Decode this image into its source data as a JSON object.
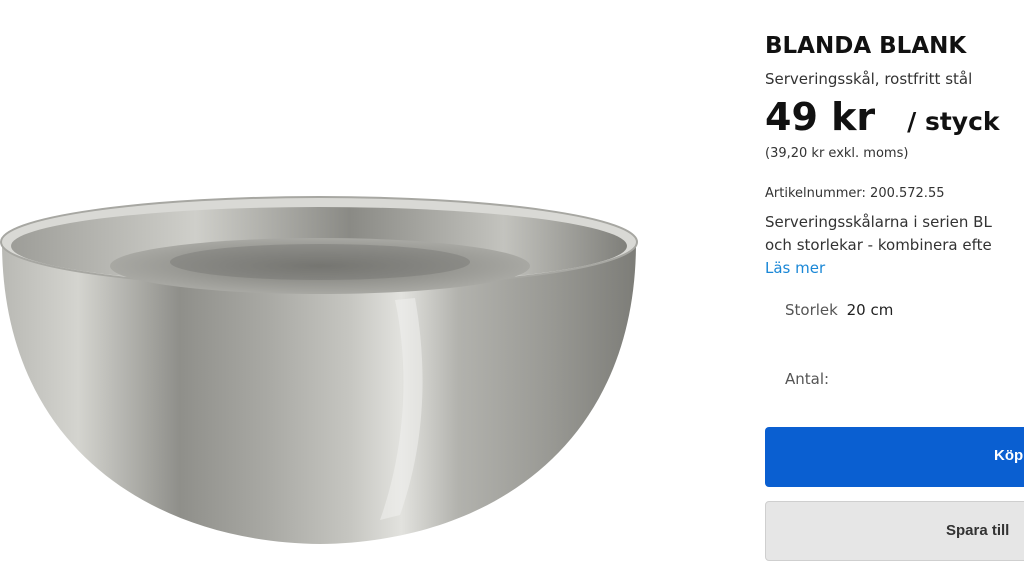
{
  "product": {
    "name": "BLANDA BLANK",
    "subtitle": "Serveringsskål, rostfritt stål",
    "price": "49 kr",
    "unit": "/ styck",
    "price_excl_vat": "(39,20 kr exkl. moms)",
    "article_number": "Artikelnummer: 200.572.55",
    "description_line1": "Serveringsskålarna i serien BL",
    "description_line2": "och storlekar - kombinera efte",
    "read_more": "Läs mer",
    "size_label": "Storlek",
    "size_value": "20 cm",
    "quantity_label": "Antal:",
    "image_icon": "stainless-steel-bowl"
  },
  "actions": {
    "buy_label": "Köp",
    "save_label": "Spara till"
  },
  "colors": {
    "buy_button": "#0a5fd1",
    "save_button": "#e6e6e6",
    "link": "#1a87d6"
  }
}
